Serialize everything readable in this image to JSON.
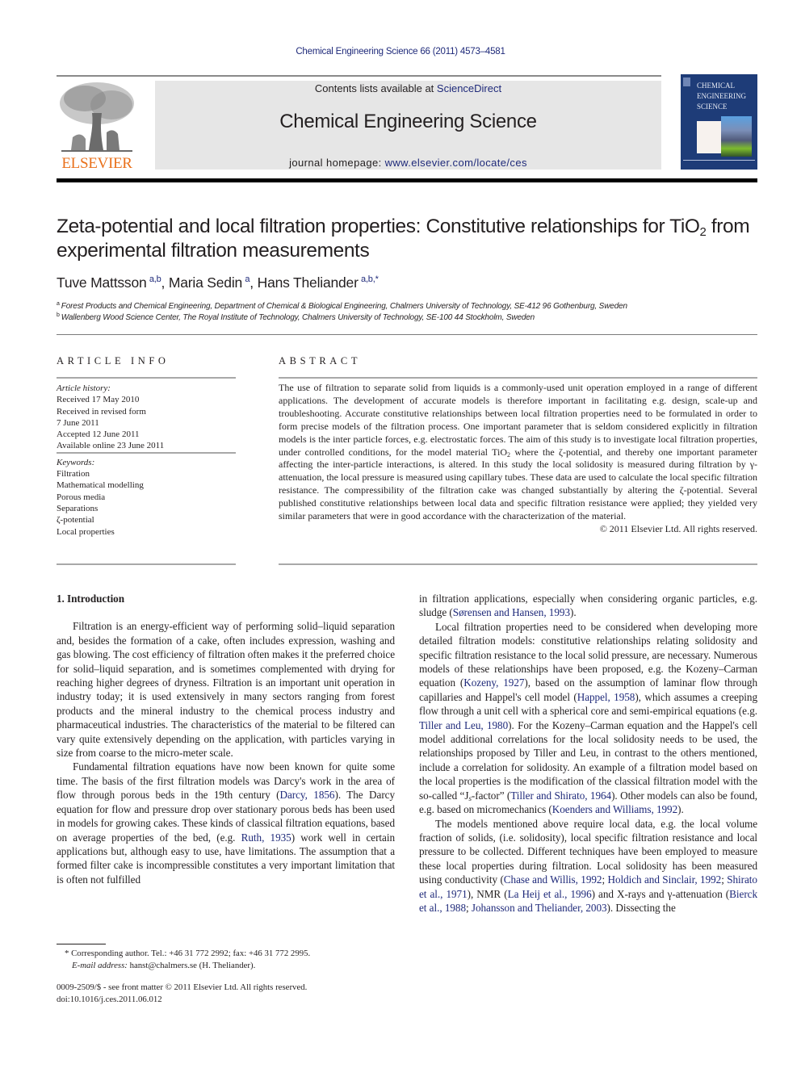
{
  "header": {
    "citation": "Chemical Engineering Science 66 (2011) 4573–4581",
    "publisher_wordmark": "ELSEVIER",
    "contents_prefix": "Contents lists available at ",
    "contents_link": "ScienceDirect",
    "journal_title": "Chemical Engineering Science",
    "homepage_prefix": "journal homepage: ",
    "homepage_link": "www.elsevier.com/locate/ces",
    "cover_title": "CHEMICAL\nENGINEERING\nSCIENCE",
    "colors": {
      "link": "#1f2a7a",
      "elsevier_orange": "#e9711c",
      "cover_blue": "#1e3c78",
      "box_gray": "#e6e6e6"
    }
  },
  "article": {
    "title_part1": "Zeta-potential and local filtration properties: Constitutive relationships for TiO",
    "title_sub": "2",
    "title_part2": " from experimental filtration measurements",
    "authors": [
      {
        "name": "Tuve Mattsson",
        "sup": "a,b"
      },
      {
        "name": "Maria Sedin",
        "sup": "a"
      },
      {
        "name": "Hans Theliander",
        "sup": "a,b,*"
      }
    ],
    "author_separator": ", ",
    "affiliations": [
      {
        "mark": "a",
        "text": "Forest Products and Chemical Engineering, Department of Chemical & Biological Engineering, Chalmers University of Technology, SE-412 96 Gothenburg, Sweden"
      },
      {
        "mark": "b",
        "text": "Wallenberg Wood Science Center, The Royal Institute of Technology, Chalmers University of Technology, SE-100 44 Stockholm, Sweden"
      }
    ]
  },
  "article_info": {
    "heading": "ARTICLE INFO",
    "history_label": "Article history:",
    "history": [
      "Received 17 May 2010",
      "Received in revised form",
      "7 June 2011",
      "Accepted 12 June 2011",
      "Available online 23 June 2011"
    ],
    "keywords_label": "Keywords:",
    "keywords": [
      "Filtration",
      "Mathematical modelling",
      "Porous media",
      "Separations",
      "ζ-potential",
      "Local properties"
    ]
  },
  "abstract": {
    "heading": "ABSTRACT",
    "text_1": "The use of filtration to separate solid from liquids is a commonly-used unit operation employed in a range of different applications. The development of accurate models is therefore important in facilitating e.g. design, scale-up and troubleshooting. Accurate constitutive relationships between local filtration properties need to be formulated in order to form precise models of the filtration process. One important parameter that is seldom considered explicitly in filtration models is the inter particle forces, e.g. electrostatic forces. The aim of this study is to investigate local filtration properties, under controlled conditions, for the model material TiO",
    "text_sub": "2",
    "text_2": " where the ζ-potential, and thereby one important parameter affecting the inter-particle interactions, is altered. In this study the local solidosity is measured during filtration by γ-attenuation, the local pressure is measured using capillary tubes. These data are used to calculate the local specific filtration resistance. The compressibility of the filtration cake was changed substantially by altering the ζ-potential. Several published constitutive relationships between local data and specific filtration resistance were applied; they yielded very similar parameters that were in good accordance with the characterization of the material.",
    "copyright": "© 2011 Elsevier Ltd. All rights reserved."
  },
  "body": {
    "section_heading": "1.  Introduction",
    "p1": "Filtration is an energy-efficient way of performing solid–liquid separation and, besides the formation of a cake, often includes expression, washing and gas blowing. The cost efficiency of filtration often makes it the preferred choice for solid–liquid separation, and is sometimes complemented with drying for reaching higher degrees of dryness. Filtration is an important unit operation in industry today; it is used extensively in many sectors ranging from forest products and the mineral industry to the chemical process industry and pharmaceutical industries. The characteristics of the material to be filtered can vary quite extensively depending on the application, with particles varying in size from coarse to the micro-meter scale.",
    "p2": {
      "t1": "Fundamental filtration equations have now been known for quite some time. The basis of the first filtration models was Darcy's work in the area of flow through porous beds in the 19th century (",
      "ref1": "Darcy, 1856",
      "t2": "). The Darcy equation for flow and pressure drop over stationary porous beds has been used in models for growing cakes. These kinds of classical filtration equations, based on average properties of the bed, (e.g. ",
      "ref2": "Ruth, 1935",
      "t3": ") work well in certain applications but, although easy to use, have limitations. The assumption that a formed filter cake is incompressible constitutes a very important limitation that is often not fulfilled"
    },
    "p2_cont": {
      "t1": "in filtration applications, especially when considering organic particles, e.g. sludge (",
      "ref1": "Sørensen and Hansen, 1993",
      "t2": ")."
    },
    "p3": {
      "t1": "Local filtration properties need to be considered when developing more detailed filtration models: constitutive relationships relating solidosity and specific filtration resistance to the local solid pressure, are necessary. Numerous models of these relationships have been proposed, e.g. the Kozeny–Carman equation (",
      "ref1": "Kozeny, 1927",
      "t2": "), based on the assumption of laminar flow through capillaries and Happel's cell model (",
      "ref2": "Happel, 1958",
      "t3": "), which assumes a creeping flow through a unit cell with a spherical core and semi-empirical equations (e.g. ",
      "ref3": "Tiller and Leu, 1980",
      "t4": "). For the Kozeny–Carman equation and the Happel's cell model additional correlations for the local solidosity needs to be used, the relationships proposed by Tiller and Leu, in contrast to the others mentioned, include a correlation for solidosity. An example of a filtration model based on the local properties is the modification of the classical filtration model with the so-called “J",
      "sub": "s",
      "t5": "-factor” (",
      "ref4": "Tiller and Shirato, 1964",
      "t6": "). Other models can also be found, e.g. based on micromechanics (",
      "ref5": "Koenders and Williams, 1992",
      "t7": ")."
    },
    "p4": {
      "t1": "The models mentioned above require local data, e.g. the local volume fraction of solids, (i.e. solidosity), local specific filtration resistance and local pressure to be collected. Different techniques have been employed to measure these local properties during filtration. Local solidosity has been measured using conductivity (",
      "ref1": "Chase and Willis, 1992",
      "s1": "; ",
      "ref2": "Holdich and Sinclair, 1992",
      "s2": "; ",
      "ref3": "Shirato et al., 1971",
      "t2": "), NMR (",
      "ref4": "La Heij et al., 1996",
      "t3": ") and X-rays and γ-attenuation (",
      "ref5": "Bierck et al., 1988",
      "s3": "; ",
      "ref6": "Johansson and Theliander, 2003",
      "t4": "). Dissecting the"
    }
  },
  "footnotes": {
    "corresponding": "* Corresponding author. Tel.: +46 31 772 2992; fax: +46 31 772 2995.",
    "email_label": "E-mail address:",
    "email_text": " hanst@chalmers.se (H. Theliander).",
    "issn": "0009-2509/$ - see front matter © 2011 Elsevier Ltd. All rights reserved.",
    "doi": "doi:10.1016/j.ces.2011.06.012"
  }
}
